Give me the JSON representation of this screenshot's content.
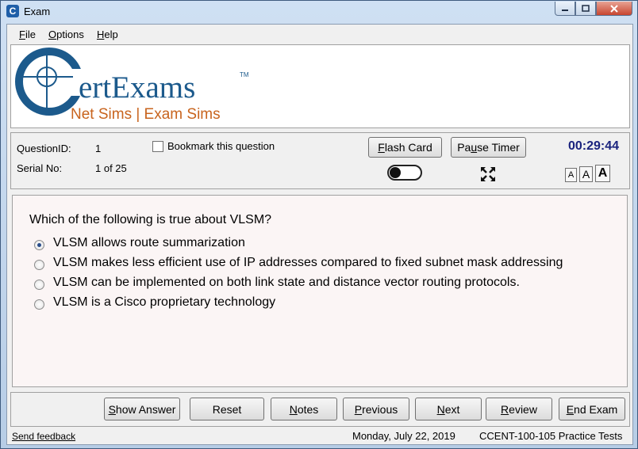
{
  "window": {
    "title": "Exam",
    "app_icon": "C"
  },
  "menu": [
    {
      "label": "File",
      "accel": "F",
      "rest": "ile"
    },
    {
      "label": "Options",
      "accel": "O",
      "rest": "ptions"
    },
    {
      "label": "Help",
      "accel": "H",
      "rest": "elp"
    }
  ],
  "logo": {
    "initial": "C",
    "name": "ertExams",
    "tm": "TM",
    "tagline": "Net Sims | Exam Sims",
    "colors": {
      "brand_blue": "#1c5a8c",
      "tagline_orange": "#c8641e"
    }
  },
  "info": {
    "question_id_label": "QuestionID:",
    "question_id": "1",
    "serial_label": "Serial No:",
    "serial": "1 of 25",
    "bookmark_label": "Bookmark this question",
    "flash_card": {
      "pre": "",
      "accel": "F",
      "post": "lash Card"
    },
    "pause_timer": {
      "pre": "Pa",
      "accel": "u",
      "post": "se Timer"
    },
    "timer": "00:29:44",
    "font_sizes": [
      "A",
      "A",
      "A"
    ]
  },
  "question": {
    "text": "Which of the following is true about VLSM?",
    "options": [
      {
        "text": "VLSM allows route summarization",
        "selected": true
      },
      {
        "text": "VLSM makes less efficient use of IP addresses compared to fixed subnet mask addressing",
        "selected": false
      },
      {
        "text": "VLSM can be implemented on both link state and distance vector routing protocols.",
        "selected": false
      },
      {
        "text": "VLSM is a Cisco proprietary technology",
        "selected": false
      }
    ]
  },
  "buttons": {
    "show_answer": {
      "pre": "",
      "accel": "S",
      "post": "how Answer"
    },
    "reset": "Reset",
    "notes": {
      "pre": "",
      "accel": "N",
      "post": "otes"
    },
    "previous": {
      "pre": "",
      "accel": "P",
      "post": "revious"
    },
    "next": {
      "pre": "",
      "accel": "N",
      "post": "ext"
    },
    "review": {
      "pre": "",
      "accel": "R",
      "post": "eview"
    },
    "end_exam": {
      "pre": "",
      "accel": "E",
      "post": "nd Exam"
    }
  },
  "status": {
    "feedback": "Send feedback",
    "date": "Monday, July 22, 2019",
    "product": "CCENT-100-105 Practice Tests"
  },
  "colors": {
    "timer": "#1a237e",
    "selected_radio": "#2a4d8a"
  }
}
